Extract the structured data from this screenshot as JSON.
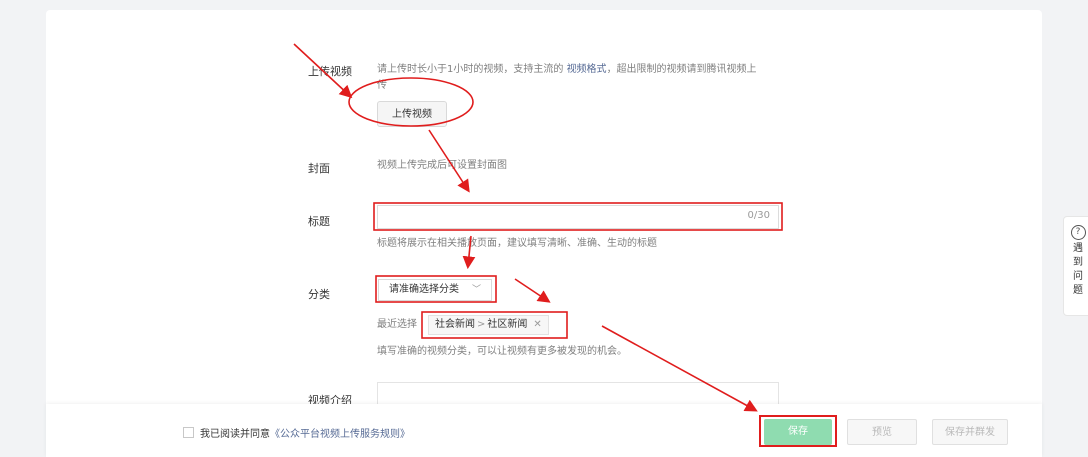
{
  "form": {
    "upload": {
      "label": "上传视频",
      "hint_before": "请上传时长小于1小时的视频，支持主流的",
      "hint_link": "视频格式",
      "hint_after": "，超出限制的视频请到腾讯视频上",
      "hint_wrap": "传",
      "button": "上传视频"
    },
    "cover": {
      "label": "封面",
      "hint": "视频上传完成后可设置封面图"
    },
    "title": {
      "label": "标题",
      "value": "",
      "count": "0/30",
      "hint": "标题将展示在相关播放页面，建议填写清晰、准确、生动的标题"
    },
    "category": {
      "label": "分类",
      "placeholder": "请准确选择分类",
      "recent_label": "最近选择",
      "recent_main": "社会新闻",
      "recent_sub": "社区新闻",
      "hint": "填写准确的视频分类，可以让视频有更多被发现的机会。"
    },
    "intro": {
      "label": "视频介绍"
    }
  },
  "footer": {
    "agree_text": "我已阅读并同意",
    "agree_rule": "《公众平台视频上传服务规则》",
    "save": "保存",
    "preview": "预览",
    "save_publish": "保存并群发"
  },
  "help": {
    "text": "遇到问题"
  },
  "colors": {
    "annotation": "#e01d1d",
    "save": "#8fdcb0",
    "link": "#576b95"
  }
}
